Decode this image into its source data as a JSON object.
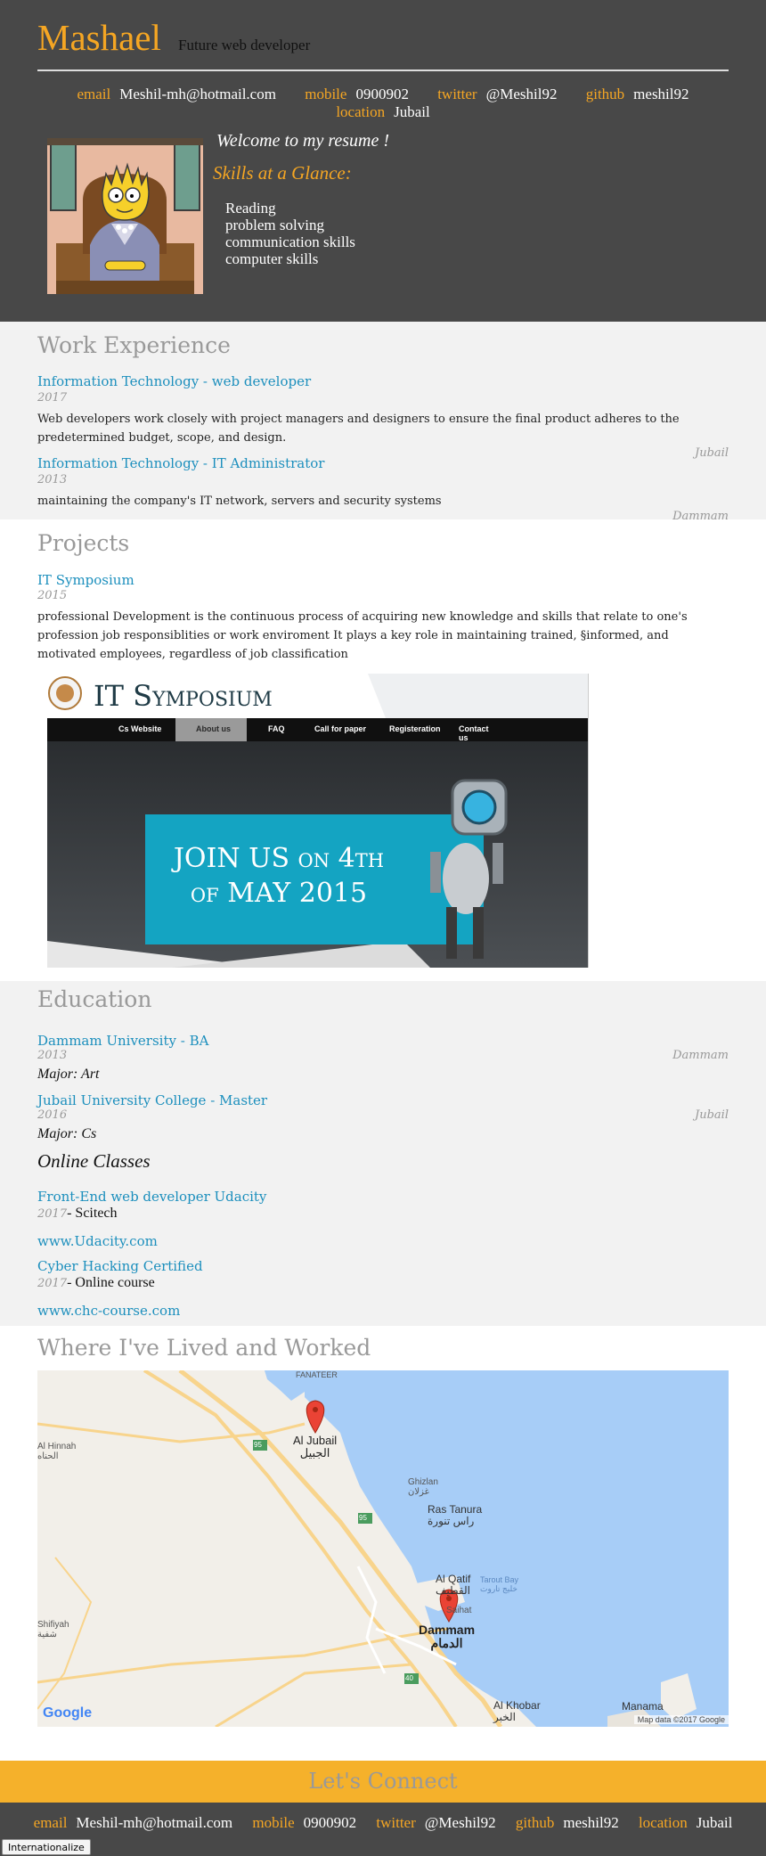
{
  "header": {
    "name": "Mashael",
    "role": "Future web developer",
    "contacts": [
      {
        "label": "email",
        "value": "Meshil-mh@hotmail.com"
      },
      {
        "label": "mobile",
        "value": "0900902"
      },
      {
        "label": "twitter",
        "value": "@Meshil92"
      },
      {
        "label": "github",
        "value": "meshil92"
      },
      {
        "label": "location",
        "value": "Jubail"
      }
    ],
    "welcome": "Welcome to my resume !",
    "skills_heading": "Skills at a Glance:",
    "skills": [
      "Reading",
      "problem solving",
      "communication skills",
      "computer skills"
    ]
  },
  "work": {
    "title": "Work Experience",
    "jobs": [
      {
        "title": "Information Technology - web developer",
        "date": "2017",
        "location": "Jubail",
        "description": "Web developers work closely with project managers and designers to ensure the final product adheres to the predetermined budget, scope, and design."
      },
      {
        "title": "Information Technology - IT Administrator",
        "date": "2013",
        "location": "Dammam",
        "description": "maintaining the company's IT network, servers and security systems"
      }
    ]
  },
  "projects": {
    "title": "Projects",
    "items": [
      {
        "title": "IT Symposium",
        "date": "2015",
        "description": "professional Development is the continuous process of acquiring new knowledge and skills that relate to one's profession job responsiblities or work enviroment It plays a key role in maintaining trained, §informed, and motivated employees, regardless of job classification",
        "image": {
          "logo_title": "IT Symposium",
          "nav": [
            "Cs Website",
            "About us",
            "FAQ",
            "Call for paper",
            "Registeration",
            "Contact us"
          ],
          "banner_line1": "JOIN US on 4th",
          "banner_line2": "of MAY 2015"
        }
      }
    ]
  },
  "education": {
    "title": "Education",
    "schools": [
      {
        "name": "Dammam University - BA",
        "date": "2013",
        "location": "Dammam",
        "major": "Major: Art"
      },
      {
        "name": "Jubail University College - Master",
        "date": "2016",
        "location": "Jubail",
        "major": "Major: Cs"
      }
    ],
    "online_heading": "Online Classes",
    "online": [
      {
        "title": "Front-End web developer Udacity",
        "date": "2017",
        "school": "- Scitech",
        "url": "www.Udacity.com"
      },
      {
        "title": "Cyber Hacking Certified",
        "date": "2017",
        "school": "- Online course",
        "url": "www.chc-course.com"
      }
    ]
  },
  "map": {
    "title": "Where I've Lived and Worked",
    "places": [
      {
        "name": "FANATEER"
      },
      {
        "name": "Al Jubail",
        "name_ar": "الجبيل"
      },
      {
        "name": "Al Hinnah",
        "name_ar": "الحناه"
      },
      {
        "name": "Ghizlan",
        "name_ar": "غزلان"
      },
      {
        "name": "Ras Tanura",
        "name_ar": "راس تنورة"
      },
      {
        "name": "Al Qatif",
        "name_ar": "القطيف"
      },
      {
        "name": "Tarout Bay",
        "name_ar": "خليج تاروت"
      },
      {
        "name": "Saihat"
      },
      {
        "name": "Dammam",
        "name_ar": "الدمام"
      },
      {
        "name": "Shifiyah",
        "name_ar": "شفية"
      },
      {
        "name": "Al Khobar",
        "name_ar": "الخبر"
      },
      {
        "name": "Manama"
      }
    ],
    "road_labels": [
      "95",
      "95",
      "40"
    ],
    "attribution": "Map data ©2017 Google",
    "logo": "Google"
  },
  "footer": {
    "connect": "Let's Connect",
    "contacts": [
      {
        "label": "email",
        "value": "Meshil-mh@hotmail.com"
      },
      {
        "label": "mobile",
        "value": "0900902"
      },
      {
        "label": "twitter",
        "value": "@Meshil92"
      },
      {
        "label": "github",
        "value": "meshil92"
      },
      {
        "label": "location",
        "value": "Jubail"
      }
    ],
    "button": "Internationalize"
  },
  "colors": {
    "accent": "#f5a623",
    "link": "#1c8fbd",
    "header_bg": "#484848",
    "section_gray": "#f2f2f2",
    "connect_bg": "#f5b12b"
  }
}
